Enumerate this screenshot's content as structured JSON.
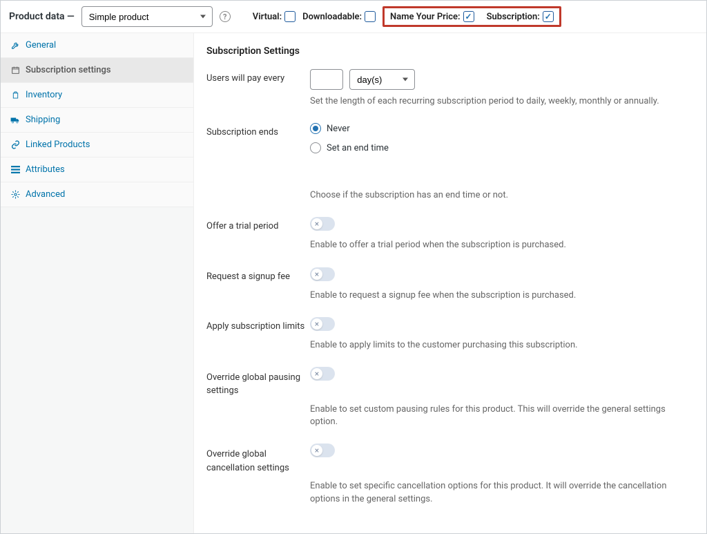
{
  "header": {
    "title": "Product data —",
    "product_type": "Simple product",
    "virtual_label": "Virtual:",
    "virtual_checked": false,
    "downloadable_label": "Downloadable:",
    "downloadable_checked": false,
    "nyp_label": "Name Your Price:",
    "nyp_checked": true,
    "subscription_label": "Subscription:",
    "subscription_checked": true
  },
  "sidebar": {
    "items": [
      {
        "icon": "wrench",
        "label": "General"
      },
      {
        "icon": "calendar",
        "label": "Subscription settings"
      },
      {
        "icon": "inventory",
        "label": "Inventory"
      },
      {
        "icon": "truck",
        "label": "Shipping"
      },
      {
        "icon": "link",
        "label": "Linked Products"
      },
      {
        "icon": "list",
        "label": "Attributes"
      },
      {
        "icon": "gear",
        "label": "Advanced"
      }
    ],
    "active_index": 1
  },
  "content": {
    "title": "Subscription Settings",
    "pay_every": {
      "label": "Users will pay every",
      "value": "",
      "unit": "day(s)",
      "desc": "Set the length of each recurring subscription period to daily, weekly, monthly or annually."
    },
    "ends": {
      "label": "Subscription ends",
      "options": [
        {
          "label": "Never",
          "checked": true
        },
        {
          "label": "Set an end time",
          "checked": false
        }
      ],
      "desc": "Choose if the subscription has an end time or not."
    },
    "trial": {
      "label": "Offer a trial period",
      "on": false,
      "desc": "Enable to offer a trial period when the subscription is purchased."
    },
    "signup_fee": {
      "label": "Request a signup fee",
      "on": false,
      "desc": "Enable to request a signup fee when the subscription is purchased."
    },
    "limits": {
      "label": "Apply subscription limits",
      "on": false,
      "desc": "Enable to apply limits to the customer purchasing this subscription."
    },
    "pausing": {
      "label": "Override global pausing settings",
      "on": false,
      "desc": "Enable to set custom pausing rules for this product. This will override the general settings option."
    },
    "cancel": {
      "label": "Override global cancellation settings",
      "on": false,
      "desc": "Enable to set specific cancellation options for this product. It will override the cancellation options in the general settings."
    }
  }
}
